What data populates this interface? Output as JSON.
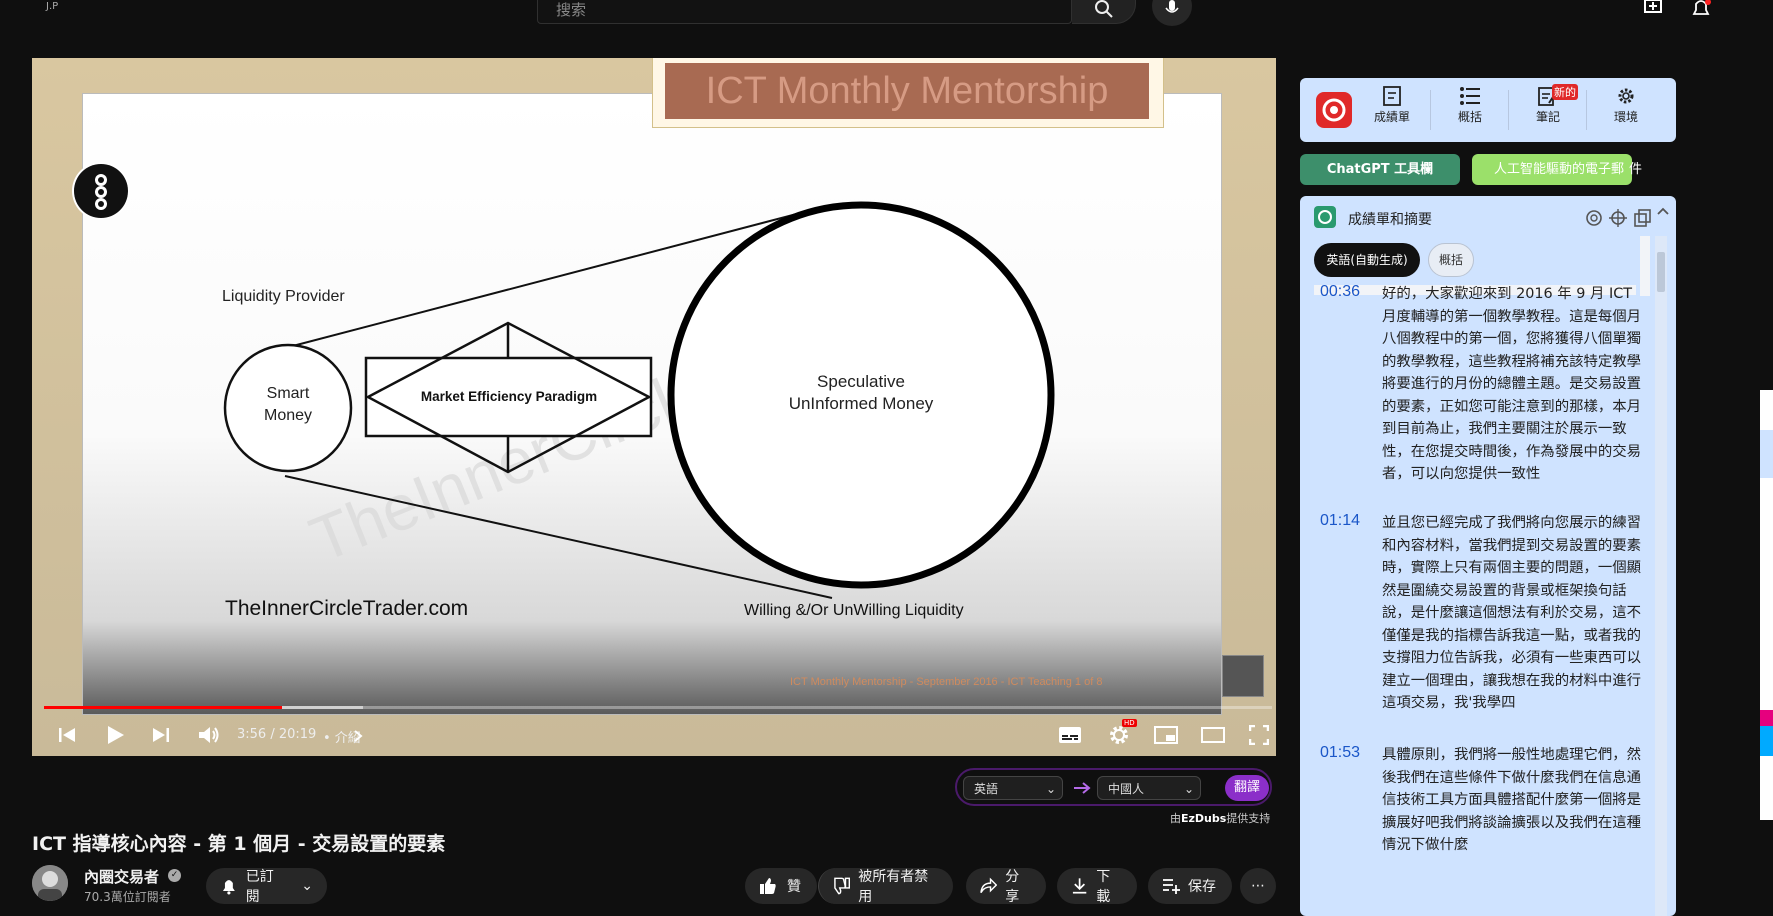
{
  "header": {
    "brand": "J.P",
    "search_placeholder": "搜索"
  },
  "slide": {
    "title": "ICT Monthly Mentorship",
    "liquidity_provider": "Liquidity Provider",
    "smart_money_1": "Smart",
    "smart_money_2": "Money",
    "paradigm": "Market Efficiency Paradigm",
    "speculative_1": "Speculative",
    "speculative_2": "UnInformed Money",
    "website": "TheInnerCircleTrader.com",
    "willing": "Willing &/Or UnWilling Liquidity",
    "watermark": "TheInnerCircleTrader.com",
    "footer": "ICT Monthly Mentorship - September 2016 - ICT Teaching 1 of 8"
  },
  "player": {
    "time": "3:56 / 20:19",
    "chapter": "• 介紹",
    "progress": 0.194,
    "buffered": 0.26,
    "hd_badge": "HD"
  },
  "translate": {
    "source_lang": "英語",
    "target_lang": "中國人",
    "button": "翻譯",
    "powered_prefix": "由",
    "powered_brand": "EzDubs",
    "powered_suffix": "提供支持"
  },
  "video": {
    "title": "ICT 指導核心內容 - 第 1 個月 - 交易設置的要素",
    "channel": "內圈交易者",
    "subscribers": "70.3萬位訂閱者",
    "subscribed_label": "已訂閱",
    "like_label": "贊",
    "dislike_label": "被所有者禁用",
    "share_label": "分享",
    "download_label": "下載",
    "save_label": "保存"
  },
  "extension": {
    "items": [
      "成績單",
      "概括",
      "筆記",
      "環境"
    ],
    "new_badge": "新的",
    "chatgpt_button": "ChatGPT 工具欄",
    "ai_button": "人工智能驅動的電子郵",
    "ai_button_tail": "件"
  },
  "transcript": {
    "title": "成績單和摘要",
    "tab_active": "英語(自動生成)",
    "tab_other": "概括",
    "entries": [
      {
        "time": "00:36",
        "text": "好的，大家歡迎來到 2016 年 9 月 ICT 月度輔導的第一個教學教程。這是每個月八個教程中的第一個，您將獲得八個單獨的教學教程，這些教程將補充該特定教學將要進行的月份的總體主題。是交易設置的要素，正如您可能注意到的那樣，本月到目前為止，我們主要關注於展示一致性，在您提交時間後，作為發展中的交易者，可以向您提供一致性"
      },
      {
        "time": "01:14",
        "text": "並且您已經完成了我們將向您展示的練習和內容材料，當我們提到交易設置的要素時，實際上只有兩個主要的問題，一個顯然是圍繞交易設置的背景或框架換句話說，是什麼讓這個想法有利於交易，這不僅僅是我的指標告訴我這一點，或者我的支撐阻力位告訴我，必須有一些東西可以建立一個理由，讓我想在我的材料中進行這項交易，我'我學四"
      },
      {
        "time": "01:53",
        "text": "具體原則，我們將一般性地處理它們，然後我們在這些條件下做什麼我們在信息通信技術工具方面具體搭配什麼第一個將是擴展好吧我們將談論擴張以及我們在這種情況下做什麼"
      }
    ]
  },
  "colors": {
    "progress_red": "#ff0000",
    "translate_purple": "#8b2fc9",
    "timestamp_blue": "#1a56c8",
    "panel_bg": "#cfe3ff"
  }
}
